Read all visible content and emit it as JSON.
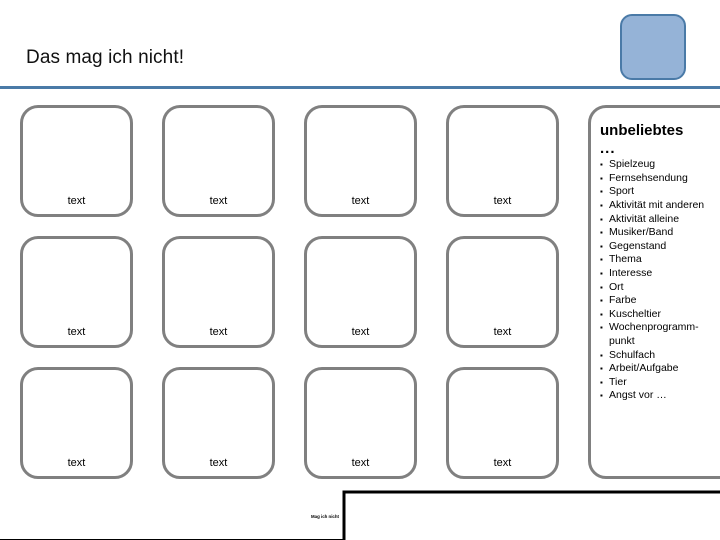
{
  "slide": {
    "title": "Das mag ich nicht!",
    "accent_color": "#4a7aa7",
    "badge_fill": "#95b3d7",
    "card_border_color": "#808080"
  },
  "corner_badge": {
    "name": "corner-badge"
  },
  "grid": {
    "rows": 3,
    "columns": 4,
    "cells": [
      {
        "label": "text"
      },
      {
        "label": "text"
      },
      {
        "label": "text"
      },
      {
        "label": "text"
      },
      {
        "label": "text"
      },
      {
        "label": "text"
      },
      {
        "label": "text"
      },
      {
        "label": "text"
      },
      {
        "label": "text"
      },
      {
        "label": "text"
      },
      {
        "label": "text"
      },
      {
        "label": "text"
      }
    ]
  },
  "list_card": {
    "heading": "unbeliebtes",
    "ellipsis": "...",
    "items": [
      "Spielzeug",
      "Fernsehsendung",
      "Sport",
      "Aktivität mit anderen",
      "Aktivität alleine",
      "Musiker/Band",
      "Gegenstand",
      "Thema",
      "Interesse",
      "Ort",
      "Farbe",
      "Kuscheltier",
      "Wochenprogramm-punkt",
      "Schulfach",
      "Arbeit/Aufgabe",
      "Tier",
      "Angst vor …"
    ]
  },
  "footer": {
    "note": "Mag ich nicht"
  }
}
